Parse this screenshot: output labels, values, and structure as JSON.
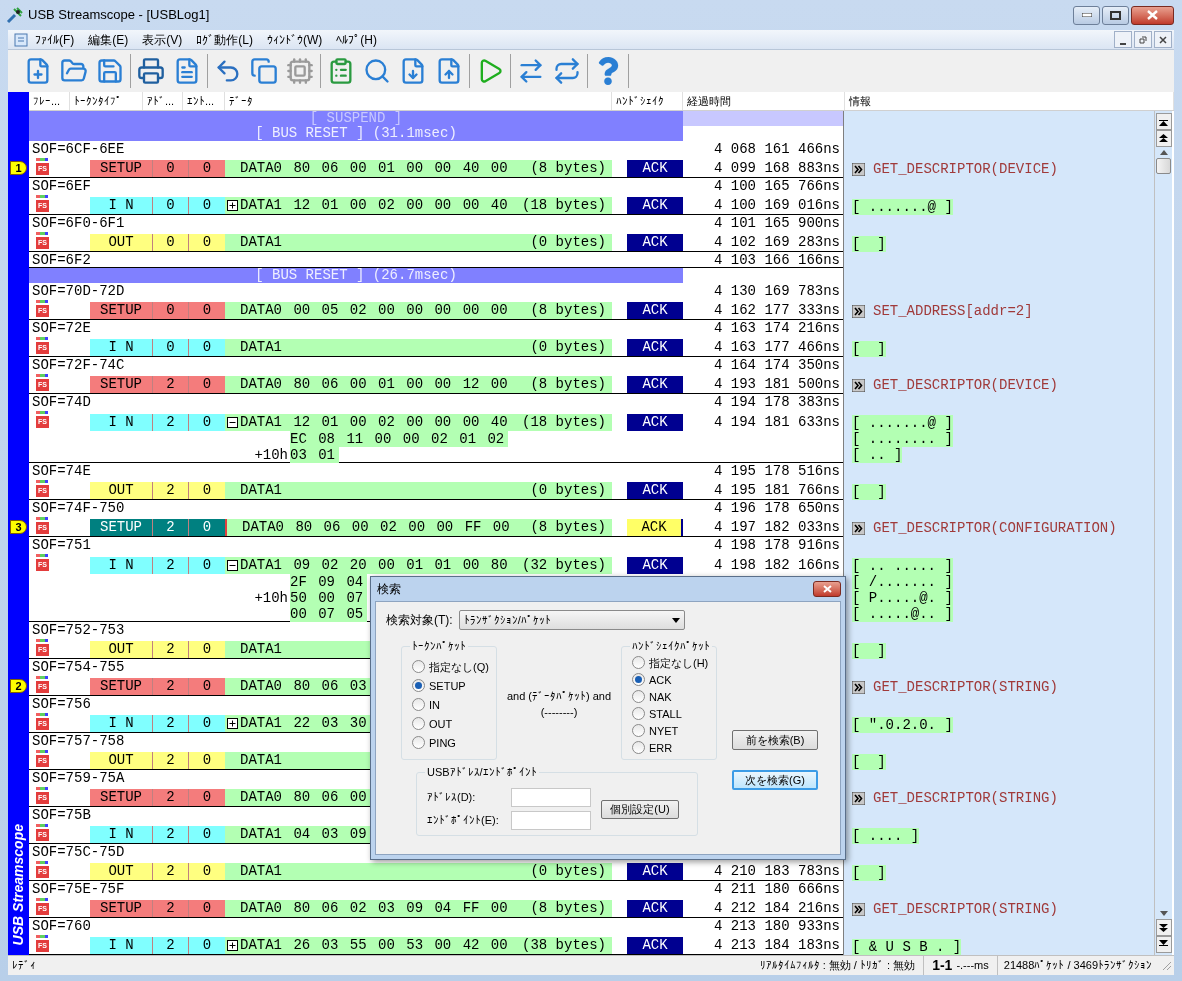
{
  "window": {
    "title": "USB Streamscope - [USBLog1]"
  },
  "menu": [
    "ﾌｧｲﾙ(F)",
    "編集(E)",
    "表示(V)",
    "ﾛｸﾞ動作(L)",
    "ｳｨﾝﾄﾞｳ(W)",
    "ﾍﾙﾌﾟ(H)"
  ],
  "toolbar": [
    [
      {
        "kind": "new",
        "disabled": false
      },
      {
        "kind": "open",
        "disabled": false
      },
      {
        "kind": "save",
        "disabled": false
      }
    ],
    [
      {
        "kind": "print",
        "disabled": false
      },
      {
        "kind": "preview",
        "disabled": false
      }
    ],
    [
      {
        "kind": "undo",
        "disabled": false
      },
      {
        "kind": "copy",
        "disabled": false
      },
      {
        "kind": "chip",
        "disabled": true
      }
    ],
    [
      {
        "kind": "settings",
        "disabled": false
      },
      {
        "kind": "search",
        "disabled": false
      },
      {
        "kind": "search_down",
        "disabled": false
      },
      {
        "kind": "search_up",
        "disabled": false
      }
    ],
    [
      {
        "kind": "play",
        "disabled": false
      }
    ],
    [
      {
        "kind": "link_out",
        "disabled": false
      },
      {
        "kind": "link_in",
        "disabled": false
      }
    ],
    [
      {
        "kind": "help",
        "disabled": false
      }
    ]
  ],
  "side_label": "USB Streamscope",
  "columns": [
    "ﾌﾚｰ...",
    "ﾄｰｸﾝﾀｲﾌﾟ",
    "ｱﾄﾞ...",
    "ｴﾝﾄ...",
    "ﾃﾞｰﾀ",
    "ﾊﾝﾄﾞｼｪｲｸ",
    "経過時間",
    "情報"
  ],
  "rows": [
    {
      "kind": "suspend",
      "text": "[ SUSPEND ]"
    },
    {
      "kind": "bus_reset",
      "text": "[ BUS RESET ] (31.1msec)"
    },
    {
      "kind": "frame",
      "sof": "SOF=6CF-6EE",
      "sof_time": "4 068 161 466ns",
      "transaction": {
        "marker": "1",
        "speed": "FS",
        "kind": "setup",
        "token": "SETUP",
        "addr": "0",
        "endp": "0",
        "selected": false,
        "pid": "DATA0",
        "bytes": "80 06 00 01 00 00 40 00",
        "size": "(8 bytes)",
        "handshake": "ACK",
        "time": "4 099 168 883ns",
        "info": {
          "kind": "request",
          "text": "GET_DESCRIPTOR(DEVICE)"
        }
      }
    },
    {
      "kind": "frame",
      "sof": "SOF=6EF",
      "sof_time": "4 100 165 766ns",
      "transaction": {
        "speed": "FS",
        "kind": "in",
        "token": "I N",
        "addr": "0",
        "endp": "0",
        "selected": false,
        "expanded": false,
        "pid": "DATA1",
        "bytes": "12 01 00 02 00 00 00 40",
        "size": "(18 bytes)",
        "handshake": "ACK",
        "time": "4 100 169 016ns",
        "info": {
          "kind": "dump",
          "lines": [
            "[ .......@ ]"
          ]
        }
      }
    },
    {
      "kind": "frame",
      "sof": "SOF=6F0-6F1",
      "sof_time": "4 101 165 900ns",
      "transaction": {
        "speed": "FS",
        "kind": "out",
        "token": "OUT",
        "addr": "0",
        "endp": "0",
        "selected": false,
        "pid": "DATA1",
        "size": "(0 bytes)",
        "handshake": "ACK",
        "time": "4 102 169 283ns",
        "info": {
          "kind": "dump",
          "lines": [
            "[  ]"
          ]
        }
      }
    },
    {
      "kind": "frame",
      "sof": "SOF=6F2",
      "sof_time": "4 103 166 166ns"
    },
    {
      "kind": "bus_reset",
      "text": "[ BUS RESET ] (26.7msec)"
    },
    {
      "kind": "frame",
      "sof": "SOF=70D-72D",
      "sof_time": "4 130 169 783ns",
      "transaction": {
        "speed": "FS",
        "kind": "setup",
        "token": "SETUP",
        "addr": "0",
        "endp": "0",
        "selected": false,
        "pid": "DATA0",
        "bytes": "00 05 02 00 00 00 00 00",
        "size": "(8 bytes)",
        "handshake": "ACK",
        "time": "4 162 177 333ns",
        "info": {
          "kind": "request",
          "text": "SET_ADDRESS[addr=2]"
        }
      }
    },
    {
      "kind": "frame",
      "sof": "SOF=72E",
      "sof_time": "4 163 174 216ns",
      "transaction": {
        "speed": "FS",
        "kind": "in",
        "token": "I N",
        "addr": "0",
        "endp": "0",
        "selected": false,
        "pid": "DATA1",
        "size": "(0 bytes)",
        "handshake": "ACK",
        "time": "4 163 177 466ns",
        "info": {
          "kind": "dump",
          "lines": [
            "[  ]"
          ]
        }
      }
    },
    {
      "kind": "frame",
      "sof": "SOF=72F-74C",
      "sof_time": "4 164 174 350ns",
      "transaction": {
        "speed": "FS",
        "kind": "setup",
        "token": "SETUP",
        "addr": "2",
        "endp": "0",
        "selected": false,
        "pid": "DATA0",
        "bytes": "80 06 00 01 00 00 12 00",
        "size": "(8 bytes)",
        "handshake": "ACK",
        "time": "4 193 181 500ns",
        "info": {
          "kind": "request",
          "text": "GET_DESCRIPTOR(DEVICE)"
        }
      }
    },
    {
      "kind": "frame",
      "sof": "SOF=74D",
      "sof_time": "4 194 178 383ns",
      "transaction": {
        "speed": "FS",
        "kind": "in",
        "token": "I N",
        "addr": "2",
        "endp": "0",
        "selected": false,
        "expanded": true,
        "pid": "DATA1",
        "bytes": "12 01 00 02 00 00 00 40",
        "size": "(18 bytes)",
        "extra": [
          {
            "bytes": "EC 08 11 00 00 02 01 02"
          },
          {
            "offset": "+10h",
            "bytes": "03 01"
          }
        ],
        "handshake": "ACK",
        "time": "4 194 181 633ns",
        "info": {
          "kind": "dump",
          "lines": [
            "[ .......@ ]",
            "[ ........ ]",
            "[ .. ]"
          ]
        }
      }
    },
    {
      "kind": "frame",
      "sof": "SOF=74E",
      "sof_time": "4 195 178 516ns",
      "transaction": {
        "speed": "FS",
        "kind": "out",
        "token": "OUT",
        "addr": "2",
        "endp": "0",
        "selected": false,
        "pid": "DATA1",
        "size": "(0 bytes)",
        "handshake": "ACK",
        "time": "4 195 181 766ns",
        "info": {
          "kind": "dump",
          "lines": [
            "[  ]"
          ]
        }
      }
    },
    {
      "kind": "frame",
      "sof": "SOF=74F-750",
      "sof_time": "4 196 178 650ns",
      "transaction": {
        "marker": "3",
        "speed": "FS",
        "kind": "setup",
        "token": "SETUP",
        "addr": "2",
        "endp": "0",
        "selected": true,
        "pid": "DATA0",
        "bytes": "80 06 00 02 00 00 FF 00",
        "size": "(8 bytes)",
        "handshake": "ACK",
        "time": "4 197 182 033ns",
        "info": {
          "kind": "request",
          "text": "GET_DESCRIPTOR(CONFIGURATION)"
        }
      }
    },
    {
      "kind": "frame",
      "sof": "SOF=751",
      "sof_time": "4 198 178 916ns",
      "transaction": {
        "speed": "FS",
        "kind": "in",
        "token": "I N",
        "addr": "2",
        "endp": "0",
        "selected": false,
        "expanded": true,
        "pid": "DATA1",
        "bytes": "09 02 20 00 01 01 00 80",
        "size": "(32 bytes)",
        "extra": [
          {
            "bytes": "2F 09 04"
          },
          {
            "offset": "+10h",
            "bytes": "50 00 07"
          },
          {
            "bytes": "00 07 05"
          }
        ],
        "handshake": "ACK",
        "time": "4 198 182 166ns",
        "info": {
          "kind": "dump",
          "lines": [
            "[ .. ..... ]",
            "[ /....... ]",
            "[ P.....@. ]",
            "[ .....@.. ]"
          ]
        }
      }
    },
    {
      "kind": "frame",
      "sof": "SOF=752-753",
      "transaction": {
        "speed": "FS",
        "kind": "out",
        "token": "OUT",
        "addr": "2",
        "endp": "0",
        "selected": false,
        "pid": "DATA1",
        "info": {
          "kind": "dump",
          "lines": [
            "[  ]"
          ]
        }
      }
    },
    {
      "kind": "frame",
      "sof": "SOF=754-755",
      "transaction": {
        "marker": "2",
        "speed": "FS",
        "kind": "setup",
        "token": "SETUP",
        "addr": "2",
        "endp": "0",
        "selected": false,
        "pid": "DATA0",
        "bytes": "80 06 03",
        "info": {
          "kind": "request",
          "text": "GET_DESCRIPTOR(STRING)"
        }
      }
    },
    {
      "kind": "frame",
      "sof": "SOF=756",
      "transaction": {
        "speed": "FS",
        "kind": "in",
        "token": "I N",
        "addr": "2",
        "endp": "0",
        "selected": false,
        "expanded": false,
        "pid": "DATA1",
        "bytes": "22 03 30",
        "info": {
          "kind": "dump",
          "lines": [
            "[ \".0.2.0. ]"
          ]
        }
      }
    },
    {
      "kind": "frame",
      "sof": "SOF=757-758",
      "transaction": {
        "speed": "FS",
        "kind": "out",
        "token": "OUT",
        "addr": "2",
        "endp": "0",
        "selected": false,
        "pid": "DATA1",
        "info": {
          "kind": "dump",
          "lines": [
            "[  ]"
          ]
        }
      }
    },
    {
      "kind": "frame",
      "sof": "SOF=759-75A",
      "transaction": {
        "speed": "FS",
        "kind": "setup",
        "token": "SETUP",
        "addr": "2",
        "endp": "0",
        "selected": false,
        "pid": "DATA0",
        "bytes": "80 06 00",
        "info": {
          "kind": "request",
          "text": "GET_DESCRIPTOR(STRING)"
        }
      }
    },
    {
      "kind": "frame",
      "sof": "SOF=75B",
      "transaction": {
        "speed": "FS",
        "kind": "in",
        "token": "I N",
        "addr": "2",
        "endp": "0",
        "selected": false,
        "pid": "DATA1",
        "bytes": "04 03 09",
        "info": {
          "kind": "dump",
          "lines": [
            "[ .... ]"
          ]
        }
      }
    },
    {
      "kind": "frame",
      "sof": "SOF=75C-75D",
      "transaction": {
        "speed": "FS",
        "kind": "out",
        "token": "OUT",
        "addr": "2",
        "endp": "0",
        "selected": false,
        "pid": "DATA1",
        "size": "(0 bytes)",
        "handshake": "ACK",
        "time": "4 210 183 783ns",
        "info": {
          "kind": "dump",
          "lines": [
            "[  ]"
          ]
        }
      }
    },
    {
      "kind": "frame",
      "sof": "SOF=75E-75F",
      "sof_time": "4 211 180 666ns",
      "transaction": {
        "speed": "FS",
        "kind": "setup",
        "token": "SETUP",
        "addr": "2",
        "endp": "0",
        "selected": false,
        "pid": "DATA0",
        "bytes": "80 06 02 03 09 04 FF 00",
        "size": "(8 bytes)",
        "handshake": "ACK",
        "time": "4 212 184 216ns",
        "info": {
          "kind": "request",
          "text": "GET_DESCRIPTOR(STRING)"
        }
      }
    },
    {
      "kind": "frame",
      "sof": "SOF=760",
      "sof_time": "4 213 180 933ns",
      "transaction": {
        "speed": "FS",
        "kind": "in",
        "token": "I N",
        "addr": "2",
        "endp": "0",
        "selected": false,
        "expanded": false,
        "pid": "DATA1",
        "bytes": "26 03 55 00 53 00 42 00",
        "size": "(38 bytes)",
        "handshake": "ACK",
        "time": "4 213 184 183ns",
        "info": {
          "kind": "dump",
          "lines": [
            "[ & U S B . ]"
          ]
        }
      }
    }
  ],
  "find_dialog": {
    "title": "検索",
    "target_label": "検索対象(T):",
    "target_value": "ﾄﾗﾝｻﾞｸｼｮﾝ/ﾊﾟｹｯﾄ",
    "token_group": {
      "title": "ﾄｰｸﾝﾊﾟｹｯﾄ",
      "options": [
        {
          "label": "指定なし(Q)",
          "selected": false
        },
        {
          "label": "SETUP",
          "selected": true
        },
        {
          "label": "IN",
          "selected": false
        },
        {
          "label": "OUT",
          "selected": false
        },
        {
          "label": "PING",
          "selected": false
        }
      ]
    },
    "middle": [
      "and (ﾃﾞｰﾀﾊﾟｹｯﾄ) and",
      "(--------)"
    ],
    "handshake_group": {
      "title": "ﾊﾝﾄﾞｼｪｲｸﾊﾟｹｯﾄ",
      "options": [
        {
          "label": "指定なし(H)",
          "selected": false
        },
        {
          "label": "ACK",
          "selected": true
        },
        {
          "label": "NAK",
          "selected": false
        },
        {
          "label": "STALL",
          "selected": false
        },
        {
          "label": "NYET",
          "selected": false
        },
        {
          "label": "ERR",
          "selected": false
        }
      ]
    },
    "address_group": {
      "title": "USBｱﾄﾞﾚｽ/ｴﾝﾄﾞﾎﾟｲﾝﾄ",
      "fields": [
        "ｱﾄﾞﾚｽ(D):",
        "ｴﾝﾄﾞﾎﾟｲﾝﾄ(E):"
      ],
      "button": "個別設定(U)"
    },
    "buttons": [
      {
        "label": "前を検索(B)",
        "default": false
      },
      {
        "label": "次を検索(G)",
        "default": true
      }
    ]
  },
  "status": {
    "ready": "ﾚﾃﾞｨ",
    "filter": "ﾘｱﾙﾀｲﾑﾌｨﾙﾀ : 無効 / ﾄﾘｶﾞ : 無効",
    "range": "1-1",
    "duration": "-.---ms",
    "counts": "21488ﾊﾟｹｯﾄ / 3469ﾄﾗﾝｻﾞｸｼｮﾝ"
  }
}
